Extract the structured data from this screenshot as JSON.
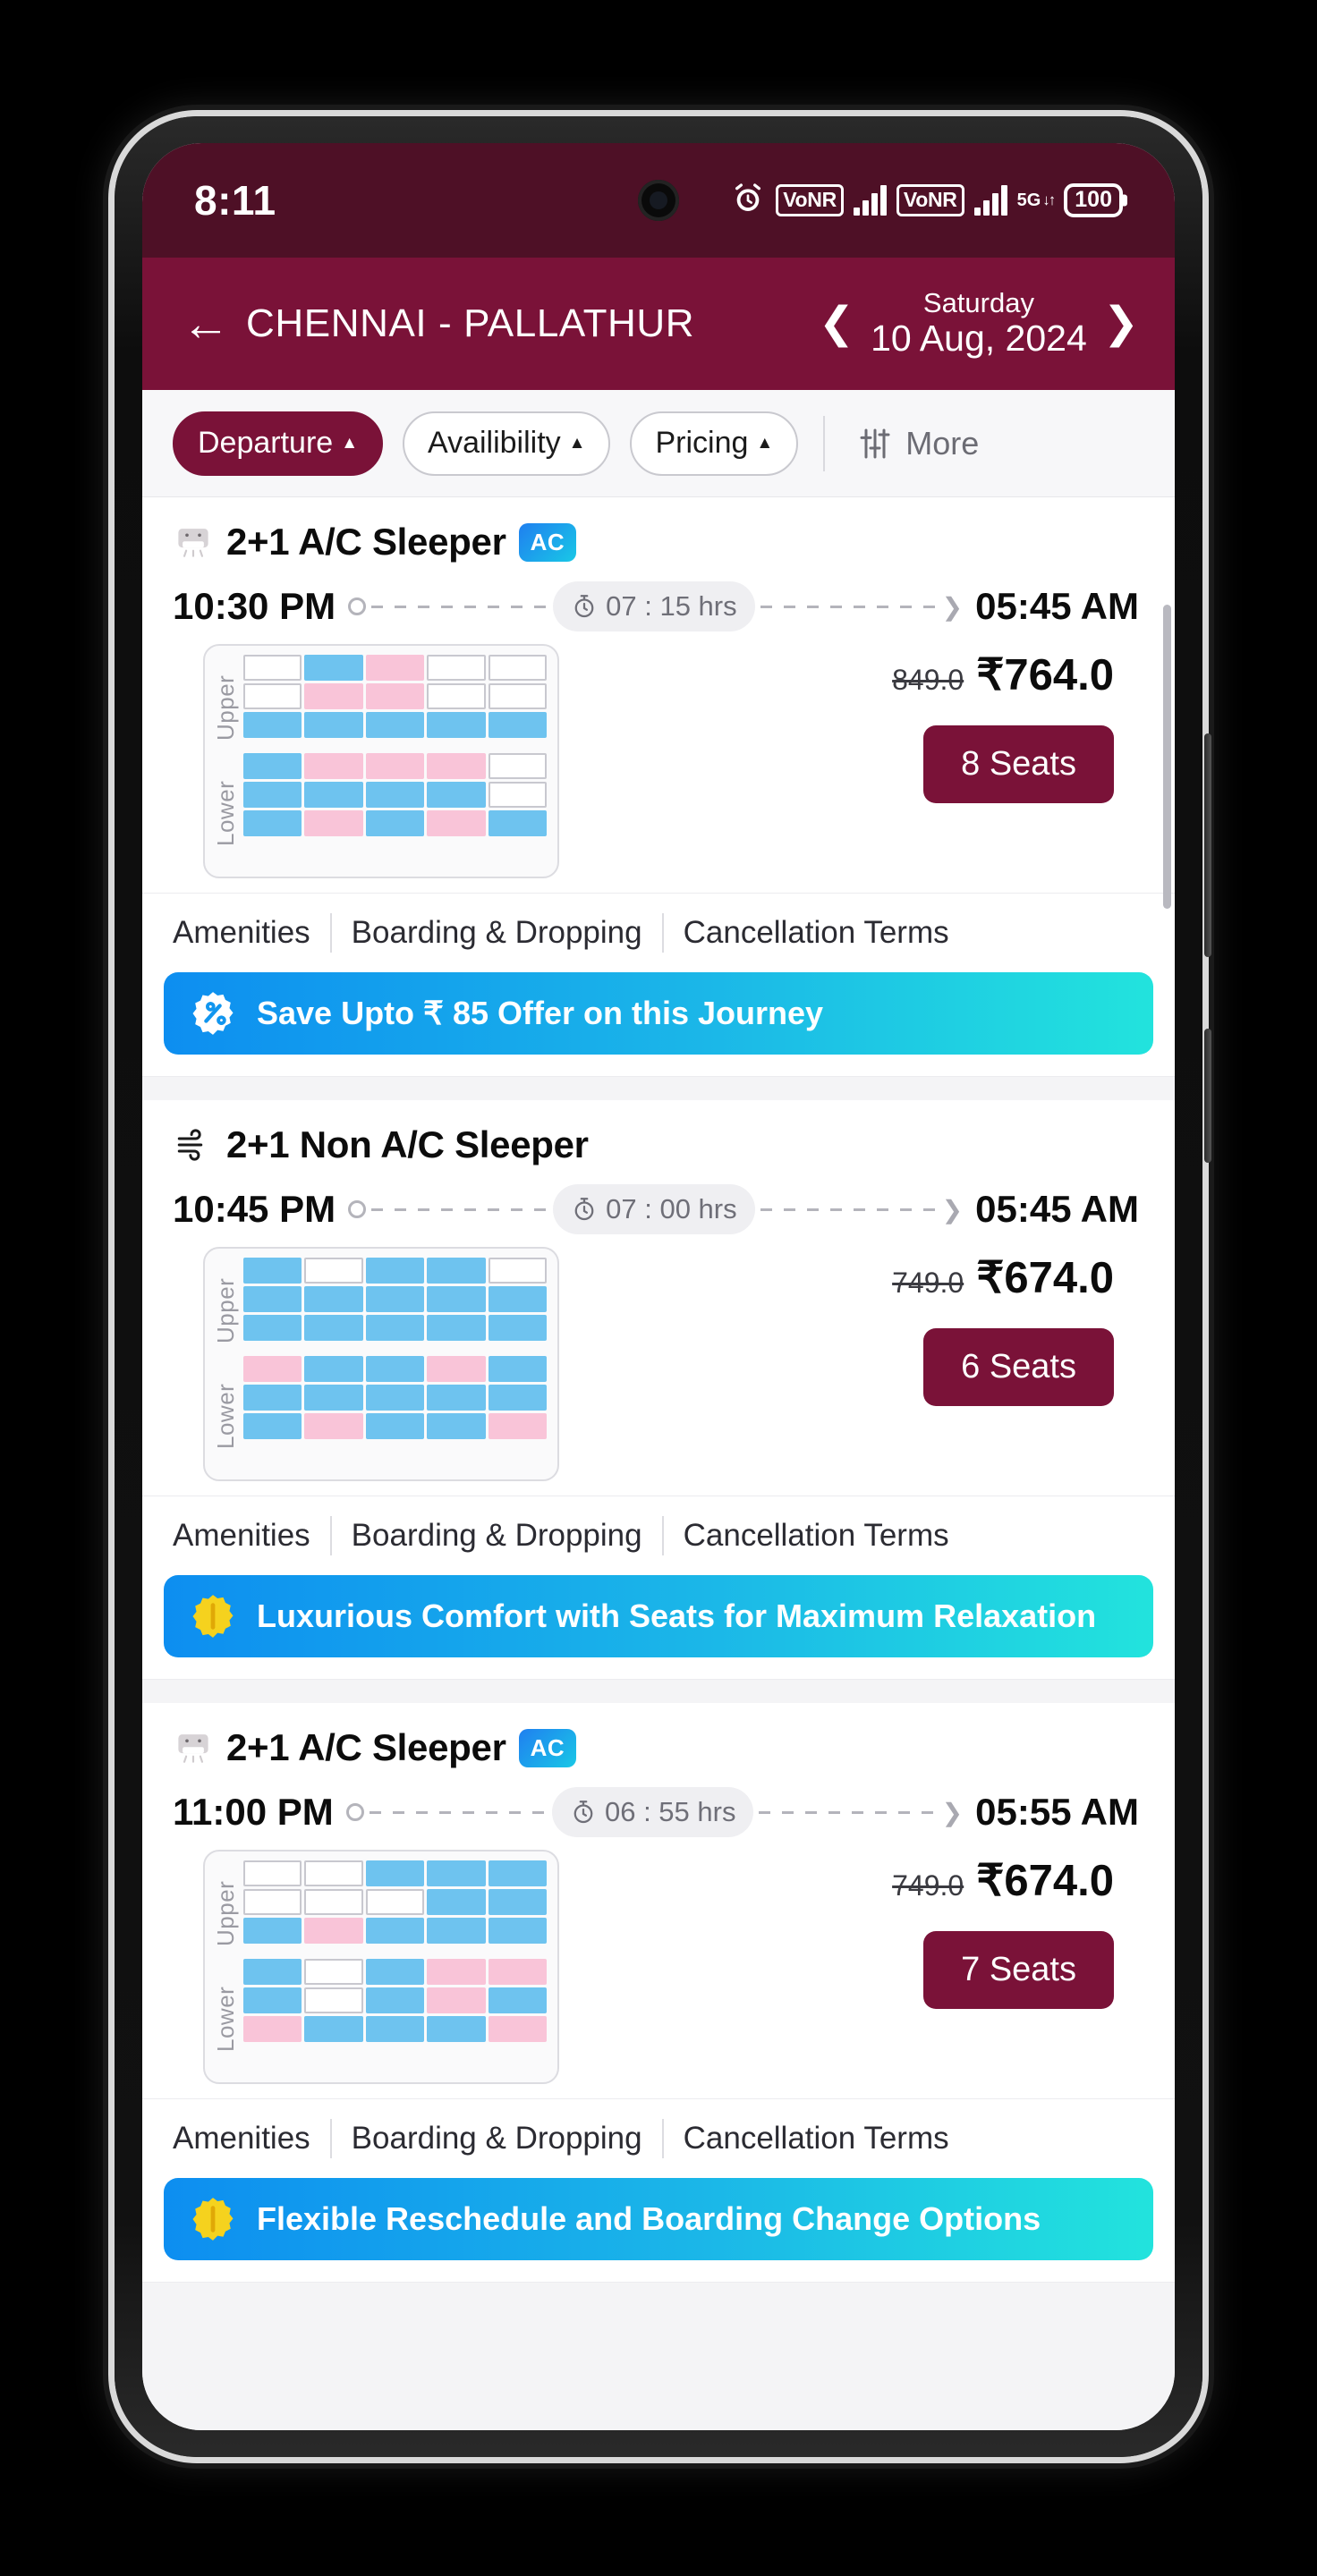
{
  "status_bar": {
    "time": "8:11",
    "alarm_icon": "alarm-clock-icon",
    "sim1_label": "VoNR",
    "sim2_label": "VoNR",
    "network_label": "5G",
    "battery_level": "100"
  },
  "header": {
    "back_icon": "back-arrow-icon",
    "route": "CHENNAI - PALLATHUR",
    "prev_icon": "chevron-left-icon",
    "next_icon": "chevron-right-icon",
    "day_name": "Saturday",
    "date": "10 Aug, 2024",
    "bg_color": "#7A1238"
  },
  "filters": {
    "chips": [
      {
        "label": "Departure",
        "caret": "▲",
        "active": true
      },
      {
        "label": "Availibility",
        "caret": "▲",
        "active": false
      },
      {
        "label": "Pricing",
        "caret": "▲",
        "active": false
      }
    ],
    "more_label": "More",
    "more_icon": "filter-sliders-icon"
  },
  "buses": [
    {
      "icon": "ac-bus-icon",
      "type": "2+1 A/C Sleeper",
      "ac_badge": "AC",
      "has_ac_badge": true,
      "departure": "10:30 PM",
      "arrival": "05:45 AM",
      "duration": "07 : 15 hrs",
      "duration_icon": "stopwatch-icon",
      "old_price": "849.0",
      "price": "₹764.0",
      "seats_label": "8 Seats",
      "links": [
        "Amenities",
        "Boarding & Dropping",
        "Cancellation Terms"
      ],
      "deck_labels": [
        "Upper",
        "Lower"
      ],
      "seat_map": {
        "upper": [
          [
            "free",
            "blue",
            "pink",
            "free",
            "free"
          ],
          [
            "free",
            "pink",
            "pink",
            "free",
            "free"
          ],
          [
            "blue",
            "blue",
            "blue",
            "blue",
            "blue"
          ]
        ],
        "lower": [
          [
            "blue",
            "pink",
            "pink",
            "pink",
            "free"
          ],
          [
            "blue",
            "blue",
            "blue",
            "blue",
            "free"
          ],
          [
            "blue",
            "pink",
            "blue",
            "pink",
            "blue"
          ]
        ]
      },
      "banner": {
        "icon": "discount-percent-icon",
        "text": "Save Upto ₹ 85 Offer on this Journey",
        "icon_color": "#ffffff"
      }
    },
    {
      "icon": "non-ac-fan-icon",
      "type": "2+1 Non A/C Sleeper",
      "ac_badge": "",
      "has_ac_badge": false,
      "departure": "10:45 PM",
      "arrival": "05:45 AM",
      "duration": "07 : 00 hrs",
      "duration_icon": "stopwatch-icon",
      "old_price": "749.0",
      "price": "₹674.0",
      "seats_label": "6 Seats",
      "links": [
        "Amenities",
        "Boarding & Dropping",
        "Cancellation Terms"
      ],
      "deck_labels": [
        "Upper",
        "Lower"
      ],
      "seat_map": {
        "upper": [
          [
            "blue",
            "free",
            "blue",
            "blue",
            "free"
          ],
          [
            "blue",
            "blue",
            "blue",
            "blue",
            "blue"
          ],
          [
            "blue",
            "blue",
            "blue",
            "blue",
            "blue"
          ]
        ],
        "lower": [
          [
            "pink",
            "blue",
            "blue",
            "pink",
            "blue"
          ],
          [
            "blue",
            "blue",
            "blue",
            "blue",
            "blue"
          ],
          [
            "blue",
            "pink",
            "blue",
            "blue",
            "pink"
          ]
        ]
      },
      "banner": {
        "icon": "gold-badge-icon",
        "text": "Luxurious Comfort with Seats for Maximum Relaxation",
        "icon_color": "#f5d21e"
      }
    },
    {
      "icon": "ac-bus-icon",
      "type": "2+1 A/C Sleeper",
      "ac_badge": "AC",
      "has_ac_badge": true,
      "departure": "11:00 PM",
      "arrival": "05:55 AM",
      "duration": "06 : 55 hrs",
      "duration_icon": "stopwatch-icon",
      "old_price": "749.0",
      "price": "₹674.0",
      "seats_label": "7 Seats",
      "links": [
        "Amenities",
        "Boarding & Dropping",
        "Cancellation Terms"
      ],
      "deck_labels": [
        "Upper",
        "Lower"
      ],
      "seat_map": {
        "upper": [
          [
            "free",
            "free",
            "blue",
            "blue",
            "blue"
          ],
          [
            "free",
            "free",
            "free",
            "blue",
            "blue"
          ],
          [
            "blue",
            "pink",
            "blue",
            "blue",
            "blue"
          ]
        ],
        "lower": [
          [
            "blue",
            "free",
            "blue",
            "pink",
            "pink"
          ],
          [
            "blue",
            "free",
            "blue",
            "pink",
            "blue"
          ],
          [
            "pink",
            "blue",
            "blue",
            "blue",
            "pink"
          ]
        ]
      },
      "banner": {
        "icon": "gold-badge-icon",
        "text": "Flexible Reschedule and Boarding Change Options",
        "icon_color": "#f5d21e"
      }
    }
  ]
}
